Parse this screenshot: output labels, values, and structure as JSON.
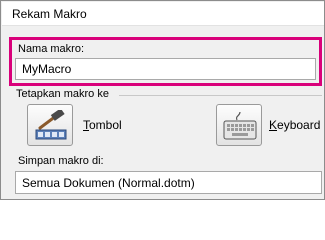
{
  "window": {
    "title": "Rekam Makro"
  },
  "macro_name": {
    "label": "Nama makro:",
    "value": "MyMacro"
  },
  "assign": {
    "group_label": "Tetapkan makro ke",
    "button_option": {
      "label_first": "T",
      "label_rest": "ombol",
      "icon": "toolbar-button-hammer-icon"
    },
    "keyboard_option": {
      "label_first": "K",
      "label_rest": "eyboard",
      "icon": "keyboard-icon"
    }
  },
  "store_in": {
    "label": "Simpan makro di:",
    "value": "Semua Dokumen (Normal.dotm)"
  },
  "colors": {
    "highlight": "#d9007a"
  }
}
